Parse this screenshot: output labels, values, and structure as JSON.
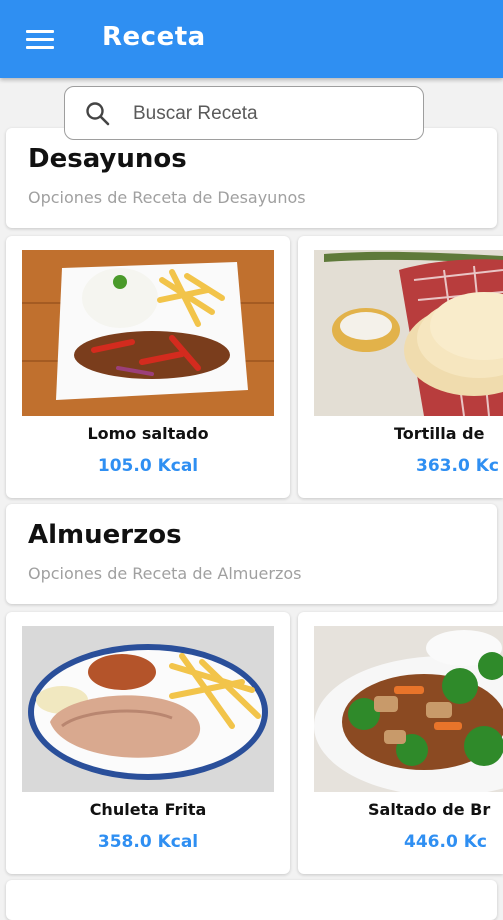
{
  "app": {
    "title": "Receta"
  },
  "search": {
    "placeholder": "Buscar Receta"
  },
  "sections": [
    {
      "title": "Desayunos",
      "subtitle": "Opciones de Receta de Desayunos",
      "items": [
        {
          "name": "Lomo saltado",
          "kcal": "105.0 Kcal"
        },
        {
          "name": "Tortilla de",
          "kcal": "363.0 Kc"
        }
      ]
    },
    {
      "title": "Almuerzos",
      "subtitle": "Opciones de Receta de Almuerzos",
      "items": [
        {
          "name": "Chuleta Frita",
          "kcal": "358.0 Kcal"
        },
        {
          "name": "Saltado de Br",
          "kcal": "446.0 Kc"
        }
      ]
    }
  ],
  "colors": {
    "primary": "#2f8ff2",
    "background": "#f2f2f2"
  }
}
